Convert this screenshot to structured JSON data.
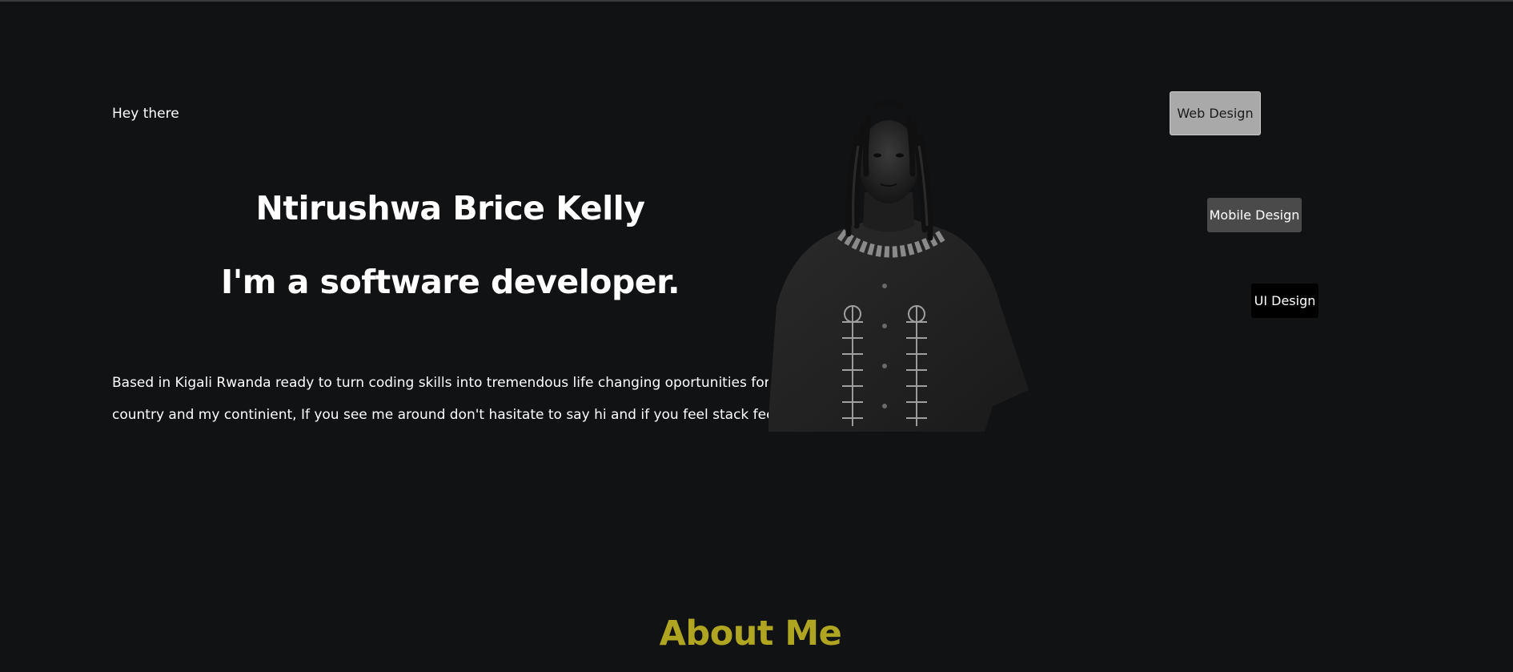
{
  "hero": {
    "greeting": "Hey there",
    "name": "Ntirushwa Brice Kelly",
    "role": "I'm a software developer.",
    "bio_line1": "Based in Kigali Rwanda ready to turn coding skills into tremendous life changing oportunities for both",
    "bio_line2": "country and my continient, If you see me around don't hasitate to say hi and if you feel stack feel free to s"
  },
  "skills": {
    "web_design": "Web Design",
    "mobile_design": "Mobile Design",
    "ui_design": "UI Design"
  },
  "about": {
    "title": "About Me"
  },
  "colors": {
    "background": "#111214",
    "accent": "#b0a521"
  },
  "portrait": {
    "icon": "person-photo"
  }
}
